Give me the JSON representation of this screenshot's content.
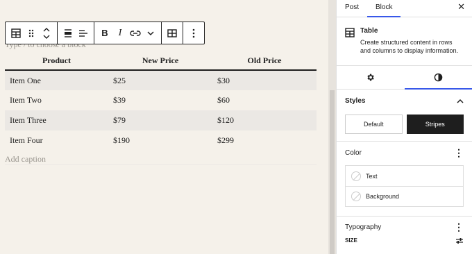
{
  "editor": {
    "placeholder": "Type / to choose a block",
    "caption_placeholder": "Add caption",
    "table": {
      "headers": [
        "Product",
        "New Price",
        "Old Price"
      ],
      "rows": [
        [
          "Item One",
          "$25",
          "$30"
        ],
        [
          "Item Two",
          "$39",
          "$60"
        ],
        [
          "Item Three",
          "$79",
          "$120"
        ],
        [
          "Item Four",
          "$190",
          "$299"
        ]
      ]
    }
  },
  "toolbar": {
    "bold_label": "B",
    "italic_label": "I"
  },
  "sidebar": {
    "tabs": [
      "Post",
      "Block"
    ],
    "active_tab": "Block",
    "close_label": "✕",
    "block": {
      "title": "Table",
      "description": "Create structured content in rows and columns to display information."
    },
    "styles": {
      "heading": "Styles",
      "options": [
        "Default",
        "Stripes"
      ],
      "active": "Stripes"
    },
    "color": {
      "heading": "Color",
      "items": [
        "Text",
        "Background"
      ]
    },
    "typography": {
      "heading": "Typography",
      "size_label": "SIZE"
    }
  },
  "colors": {
    "accent": "#3858e9",
    "stripe": "#ebe8e4",
    "canvas": "#f5f1ea"
  }
}
